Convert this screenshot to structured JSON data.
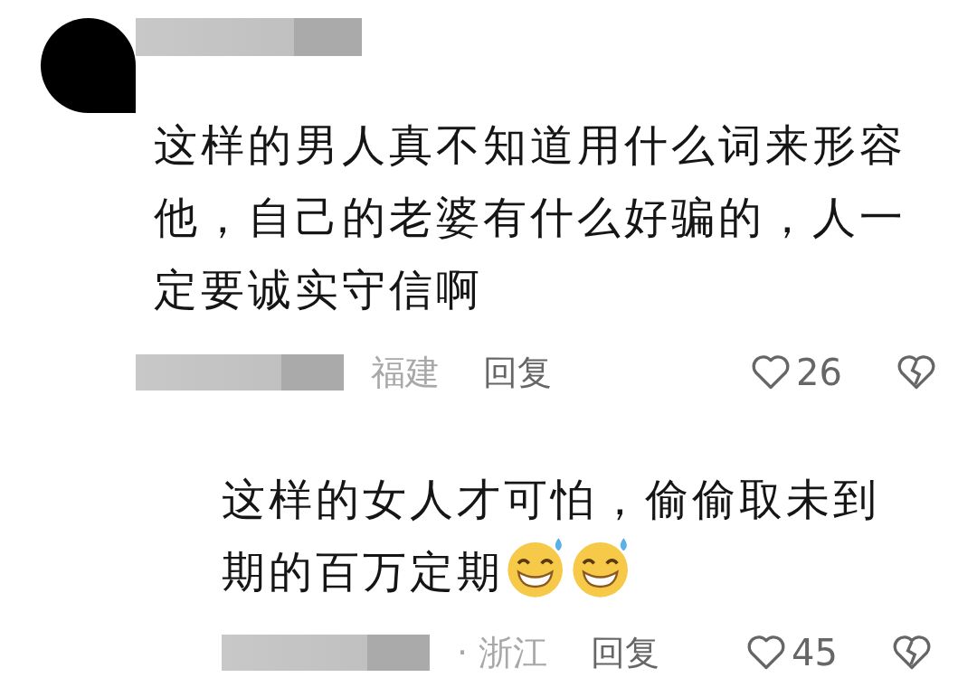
{
  "comments": [
    {
      "text": "这样的男人真不知道用什么词来形容他，自己的老婆有什么好骗的，人一定要诚实守信啊",
      "location": "福建",
      "reply_label": "回复",
      "likes": "26",
      "is_reply": false
    },
    {
      "text": "这样的女人才可怕，偷偷取未到期的百万定期",
      "trailing_icons": [
        {
          "kind": "grin-sweat"
        },
        {
          "kind": "grin-sweat"
        }
      ],
      "location": "· 浙江",
      "reply_label": "回复",
      "likes": "45",
      "is_reply": true
    }
  ]
}
